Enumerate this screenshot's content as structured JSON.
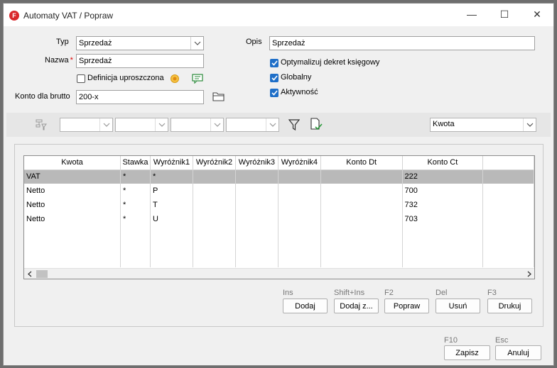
{
  "window": {
    "title": "Automaty VAT / Popraw",
    "app_icon_letter": "F",
    "minimize": "—",
    "maximize": "☐",
    "close": "✕"
  },
  "form": {
    "typ_label": "Typ",
    "typ_value": "Sprzedaż",
    "nazwa_label": "Nazwa",
    "nazwa_required": "*",
    "nazwa_value": "Sprzedaż",
    "definicja_label": "Definicja uproszczona",
    "definicja_checked": false,
    "konto_brutto_label": "Konto dla brutto",
    "konto_brutto_value": "200-x",
    "opis_label": "Opis",
    "opis_value": "Sprzedaż",
    "optymalizuj_label": "Optymalizuj dekret księgowy",
    "optymalizuj_checked": true,
    "globalny_label": "Globalny",
    "globalny_checked": true,
    "aktywnosc_label": "Aktywność",
    "aktywnosc_checked": true
  },
  "filter": {
    "combo1": "",
    "combo2": "",
    "combo3": "",
    "combo4": "",
    "kwota_value": "Kwota"
  },
  "grid": {
    "columns": [
      "Kwota",
      "Stawka",
      "Wyróżnik1",
      "Wyróżnik2",
      "Wyróżnik3",
      "Wyróżnik4",
      "Konto Dt",
      "Konto Ct"
    ],
    "rows": [
      {
        "kwota": "VAT",
        "stawka": "*",
        "w1": "*",
        "w2": "",
        "w3": "",
        "w4": "",
        "dt": "",
        "ct": "222"
      },
      {
        "kwota": "Netto",
        "stawka": "*",
        "w1": "P",
        "w2": "",
        "w3": "",
        "w4": "",
        "dt": "",
        "ct": "700"
      },
      {
        "kwota": "Netto",
        "stawka": "*",
        "w1": "T",
        "w2": "",
        "w3": "",
        "w4": "",
        "dt": "",
        "ct": "732"
      },
      {
        "kwota": "Netto",
        "stawka": "*",
        "w1": "U",
        "w2": "",
        "w3": "",
        "w4": "",
        "dt": "",
        "ct": "703"
      }
    ],
    "selected_row": 0
  },
  "actions": {
    "dodaj_shortcut": "Ins",
    "dodaj_label": "Dodaj",
    "dodajz_shortcut": "Shift+Ins",
    "dodajz_label": "Dodaj z...",
    "popraw_shortcut": "F2",
    "popraw_label": "Popraw",
    "usun_shortcut": "Del",
    "usun_label": "Usuń",
    "drukuj_shortcut": "F3",
    "drukuj_label": "Drukuj"
  },
  "footer": {
    "zapisz_shortcut": "F10",
    "zapisz_label": "Zapisz",
    "anuluj_shortcut": "Esc",
    "anuluj_label": "Anuluj"
  },
  "colors": {
    "accent": "#1f6fc8",
    "brand": "#d9262b",
    "selected_row": "#b9b9b9"
  }
}
